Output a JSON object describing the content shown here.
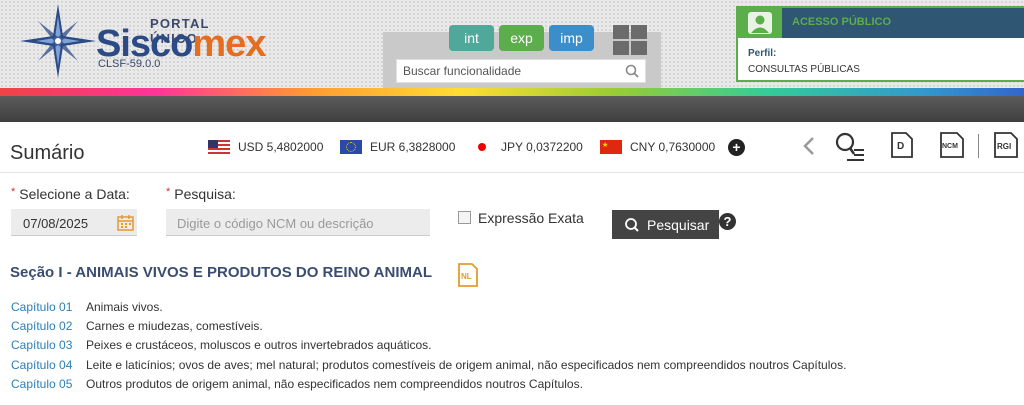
{
  "header": {
    "portal_label": "PORTAL ÚNICO",
    "brand_part1": "Sisco",
    "brand_part2": "mex",
    "version": "CLSF-59.0.0",
    "modules": [
      "int",
      "exp",
      "imp"
    ],
    "search_placeholder": "Buscar funcionalidade",
    "access": {
      "title": "ACESSO PÚBLICO",
      "perfil_label": "Perfil:",
      "perfil_value": "CONSULTAS PÚBLICAS"
    }
  },
  "summary": {
    "title": "Sumário",
    "currencies": [
      {
        "code": "USD",
        "text": "USD 5,4802000",
        "flag": "us-flag-icon"
      },
      {
        "code": "EUR",
        "text": "EUR 6,3828000",
        "flag": "eu-flag-icon"
      },
      {
        "code": "JPY",
        "text": "JPY 0,0372200",
        "flag": "jp-flag-icon"
      },
      {
        "code": "CNY",
        "text": "CNY 0,7630000",
        "flag": "cn-flag-icon"
      }
    ],
    "tools": {
      "d_label": "D",
      "ncm_label": "NCM",
      "rgi_label": "RGI"
    }
  },
  "form": {
    "date_label": "Selecione a Data:",
    "date_value": "07/08/2025",
    "search_label": "Pesquisa:",
    "search_placeholder": "Digite o código NCM ou descrição",
    "exact_label": "Expressão Exata",
    "search_button": "Pesquisar",
    "required_mark": "*"
  },
  "section": {
    "title": "Seção I - ANIMAIS VIVOS E PRODUTOS DO REINO ANIMAL",
    "nl_label": "NL",
    "chapters": [
      {
        "num": "Capítulo 01",
        "desc": "Animais vivos."
      },
      {
        "num": "Capítulo 02",
        "desc": "Carnes e miudezas, comestíveis."
      },
      {
        "num": "Capítulo 03",
        "desc": "Peixes e crustáceos, moluscos e outros invertebrados aquáticos."
      },
      {
        "num": "Capítulo 04",
        "desc": "Leite e laticínios; ovos de aves; mel natural; produtos comestíveis de origem animal, não especificados nem compreendidos noutros Capítulos."
      },
      {
        "num": "Capítulo 05",
        "desc": "Outros produtos de origem animal, não especificados nem compreendidos noutros Capítulos."
      }
    ]
  },
  "colors": {
    "brand_blue": "#2b4a86",
    "brand_orange": "#e56d1f",
    "link_blue": "#2b7fb8",
    "access_green": "#5cad4b",
    "access_navy": "#2f5672"
  }
}
